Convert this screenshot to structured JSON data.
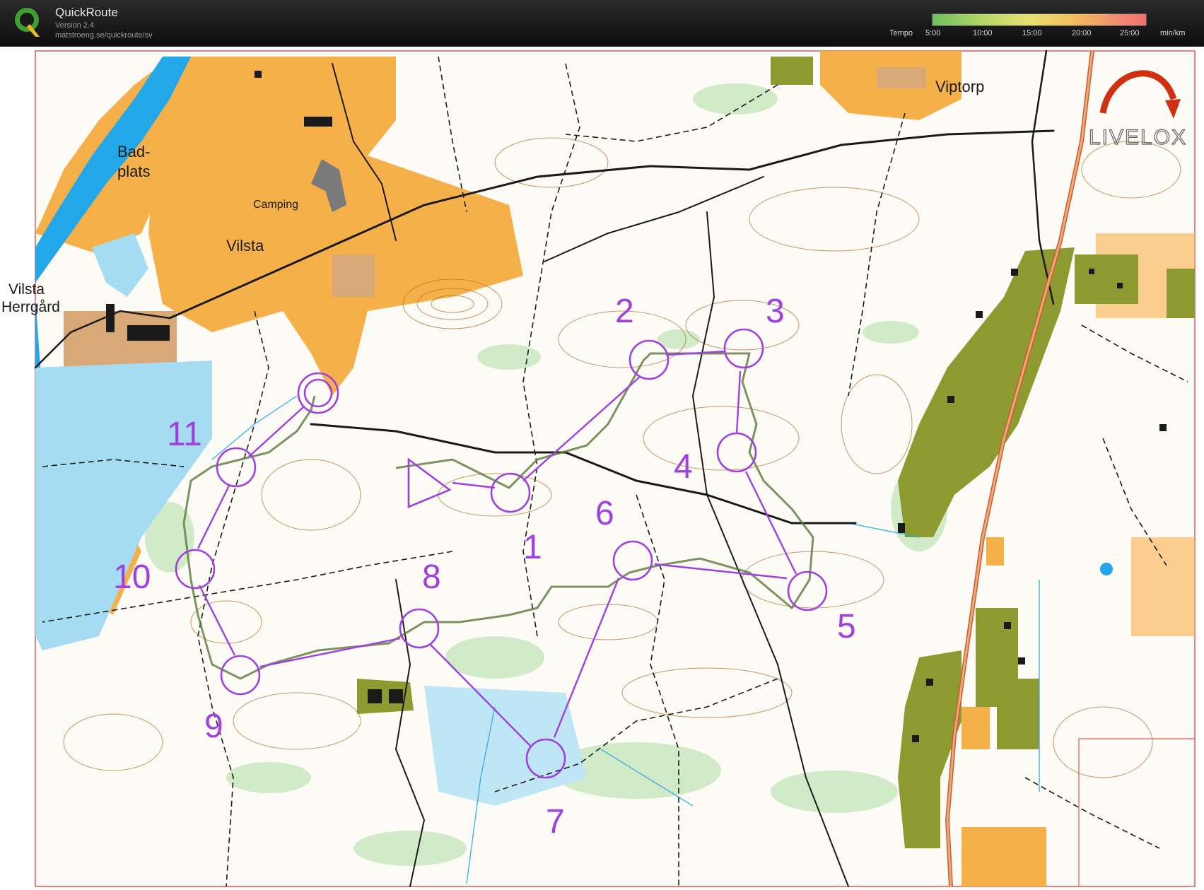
{
  "header": {
    "app_title": "QuickRoute",
    "version": "Version 2.4",
    "url": "matstroeng.se/quickroute/sv",
    "tempo_label": "Tempo",
    "tempo_ticks": [
      "5:00",
      "10:00",
      "15:00",
      "20:00",
      "25:00"
    ],
    "tempo_unit": "min/km"
  },
  "map": {
    "place_names": {
      "badplats_line1": "Bad-",
      "badplats_line2": "plats",
      "camping": "Camping",
      "vilsta": "Vilsta",
      "vilsta_herrgard_line1": "Vilsta",
      "vilsta_herrgard_line2": "Herrgård",
      "viptorp": "Viptorp"
    },
    "watermark": "LIVELOX",
    "controls": [
      "1",
      "2",
      "3",
      "4",
      "5",
      "6",
      "7",
      "8",
      "9",
      "10",
      "11"
    ]
  },
  "colors": {
    "course": "#a040e0",
    "route": "#5a7a3a",
    "open_land": "#f6b04a",
    "water": "#22a8e8",
    "green_veg": "#8c9a30",
    "contour": "#b8752a"
  }
}
